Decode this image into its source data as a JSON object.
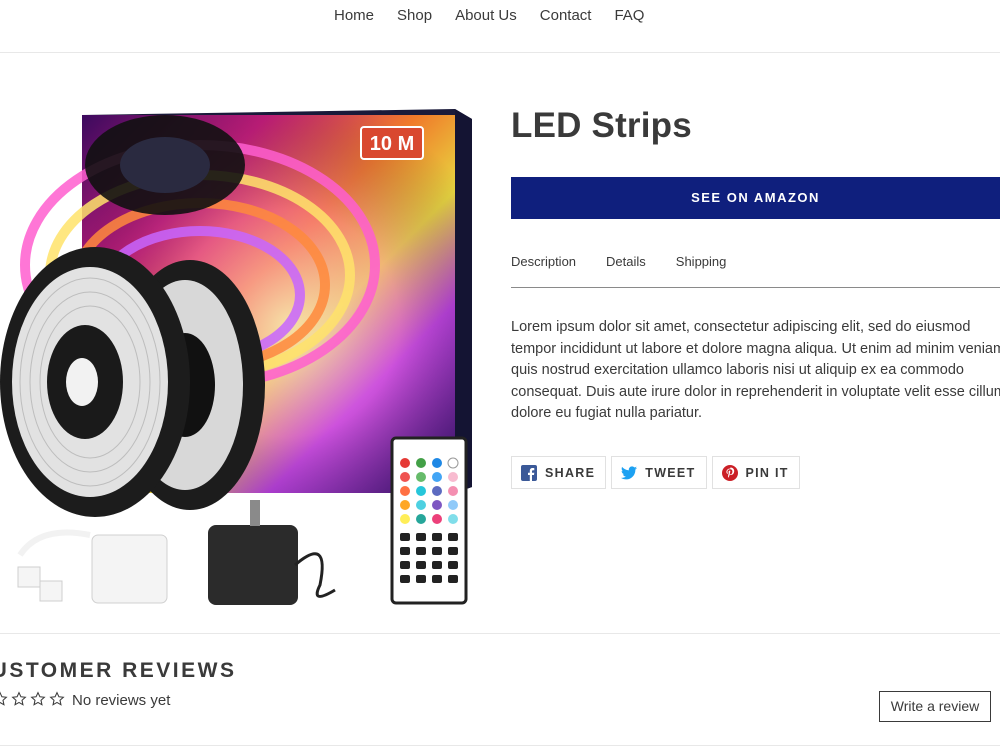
{
  "nav": {
    "items": [
      {
        "label": "Home"
      },
      {
        "label": "Shop"
      },
      {
        "label": "About Us"
      },
      {
        "label": "Contact"
      },
      {
        "label": "FAQ"
      }
    ]
  },
  "product": {
    "title": "LED Strips",
    "amazon_button_label": "SEE ON AMAZON",
    "box_badge": "10 M",
    "tabs": [
      {
        "label": "Description"
      },
      {
        "label": "Details"
      },
      {
        "label": "Shipping"
      }
    ],
    "description": "Lorem ipsum dolor sit amet, consectetur adipiscing elit, sed do eiusmod tempor incididunt ut labore et dolore magna aliqua. Ut enim ad minim veniam, quis nostrud exercitation ullamco laboris nisi ut aliquip ex ea commodo consequat. Duis aute irure dolor in reprehenderit in voluptate velit esse cillum dolore eu fugiat nulla pariatur.",
    "share": {
      "facebook_label": "SHARE",
      "twitter_label": "TWEET",
      "pinterest_label": "PIN IT"
    }
  },
  "reviews": {
    "title": "CUSTOMER REVIEWS",
    "summary": "No reviews yet",
    "write_review_label": "Write a review",
    "rating": 0,
    "max_rating": 5
  },
  "colors": {
    "primary_button": "#0f1f7d",
    "text": "#3a3a3a",
    "facebook": "#3b5998",
    "twitter": "#1da1f2",
    "pinterest": "#cb2027"
  },
  "icons": {
    "facebook": "facebook-icon",
    "twitter": "twitter-icon",
    "pinterest": "pinterest-icon",
    "star": "star-outline-icon"
  }
}
